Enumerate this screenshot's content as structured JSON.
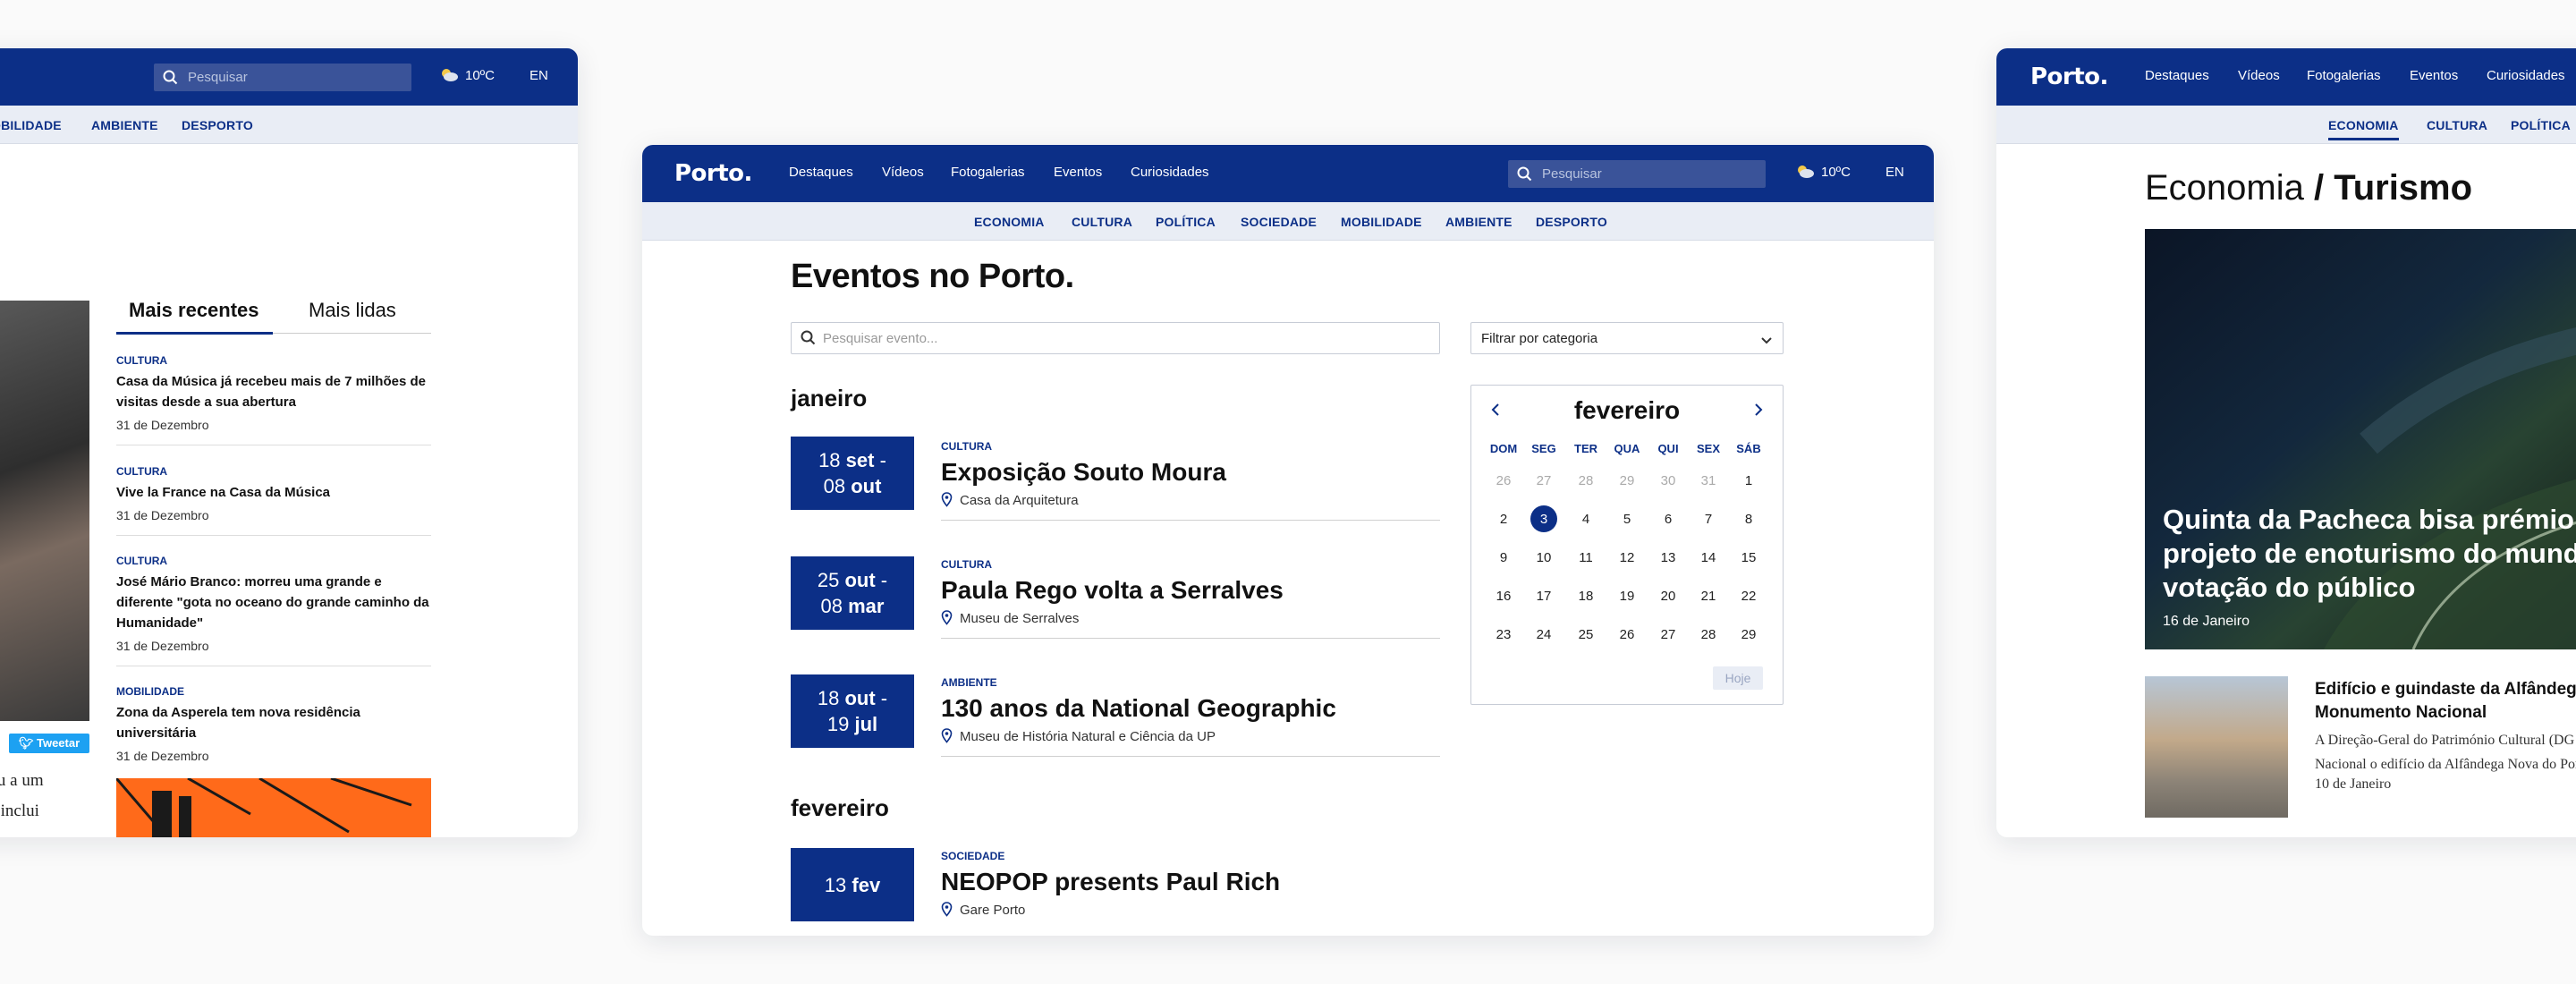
{
  "left": {
    "search_placeholder": "Pesquisar",
    "weather": "10ºC",
    "lang": "EN",
    "subnav": [
      "OBILIDADE",
      "AMBIENTE",
      "DESPORTO"
    ],
    "tabs": [
      "Mais recentes",
      "Mais lidas"
    ],
    "news": [
      {
        "cat": "CULTURA",
        "title": "Casa da Música já recebeu mais de 7 milhões de visitas desde a sua abertura",
        "date": "31 de Dezembro"
      },
      {
        "cat": "CULTURA",
        "title": "Vive la France na Casa da Música",
        "date": "31 de Dezembro"
      },
      {
        "cat": "CULTURA",
        "title": "José Mário Branco: morreu uma grande e diferente \"gota no oceano do grande caminho da Humanidade\"",
        "date": "31 de Dezembro"
      },
      {
        "cat": "MOBILIDADE",
        "title": "Zona da Asperela tem nova residência universitária",
        "date": "31 de Dezembro"
      }
    ],
    "tweet_label": "Tweetar",
    "text_lines": [
      "ondeu a um",
      "nção inclui"
    ]
  },
  "mid": {
    "logo": "Porto.",
    "nav": [
      "Destaques",
      "Vídeos",
      "Fotogalerias",
      "Eventos",
      "Curiosidades"
    ],
    "search_placeholder": "Pesquisar",
    "weather": "10ºC",
    "lang": "EN",
    "subnav": [
      "ECONOMIA",
      "CULTURA",
      "POLÍTICA",
      "SOCIEDADE",
      "MOBILIDADE",
      "AMBIENTE",
      "DESPORTO"
    ],
    "title": "Eventos no Porto.",
    "event_search_placeholder": "Pesquisar evento...",
    "filter_label": "Filtrar por categoria",
    "months": [
      "janeiro",
      "fevereiro"
    ],
    "events": [
      {
        "d1": "18",
        "m1": "set",
        "d2": "08",
        "m2": "out",
        "cat": "CULTURA",
        "title": "Exposição Souto Moura",
        "loc": "Casa da Arquitetura"
      },
      {
        "d1": "25",
        "m1": "out",
        "d2": "08",
        "m2": "mar",
        "cat": "CULTURA",
        "title": "Paula Rego volta a Serralves",
        "loc": "Museu de Serralves"
      },
      {
        "d1": "18",
        "m1": "out",
        "d2": "19",
        "m2": "jul",
        "cat": "AMBIENTE",
        "title": "130 anos da National Geographic",
        "loc": "Museu de História Natural e Ciência da UP"
      },
      {
        "d1": "13",
        "m1": "fev",
        "cat": "SOCIEDADE",
        "title": "NEOPOP presents Paul Rich",
        "loc": "Gare Porto"
      }
    ],
    "calendar": {
      "month": "fevereiro",
      "dow": [
        "DOM",
        "SEG",
        "TER",
        "QUA",
        "QUI",
        "SEX",
        "SÁB"
      ],
      "weeks": [
        [
          "26",
          "27",
          "28",
          "29",
          "30",
          "31",
          "1"
        ],
        [
          "2",
          "3",
          "4",
          "5",
          "6",
          "7",
          "8"
        ],
        [
          "9",
          "10",
          "11",
          "12",
          "13",
          "14",
          "15"
        ],
        [
          "16",
          "17",
          "18",
          "19",
          "20",
          "21",
          "22"
        ],
        [
          "23",
          "24",
          "25",
          "26",
          "27",
          "28",
          "29"
        ]
      ],
      "today": "3",
      "today_button": "Hoje"
    }
  },
  "right": {
    "logo": "Porto.",
    "nav": [
      "Destaques",
      "Vídeos",
      "Fotogalerias",
      "Eventos",
      "Curiosidades"
    ],
    "subnav": [
      "ECONOMIA",
      "CULTURA",
      "POLÍTICA"
    ],
    "heading_light": "Economia",
    "heading_bold": "/ Turismo",
    "hero_title": "Quinta da Pacheca bisa prémio projeto de enoturismo do mund votação do público",
    "hero_date": "16 de Janeiro",
    "article_title": "Edifício e guindaste da Alfândega Monumento Nacional",
    "article_desc": "A Direção-Geral do Património Cultural (DG Nacional o edifício da Alfândega Nova do Por",
    "article_date": "10 de Janeiro"
  },
  "colors": {
    "brand": "#0c2f87",
    "subnav_bg": "#e9edf5",
    "tweet": "#1da1f2",
    "promo": "#ff6a1a"
  }
}
